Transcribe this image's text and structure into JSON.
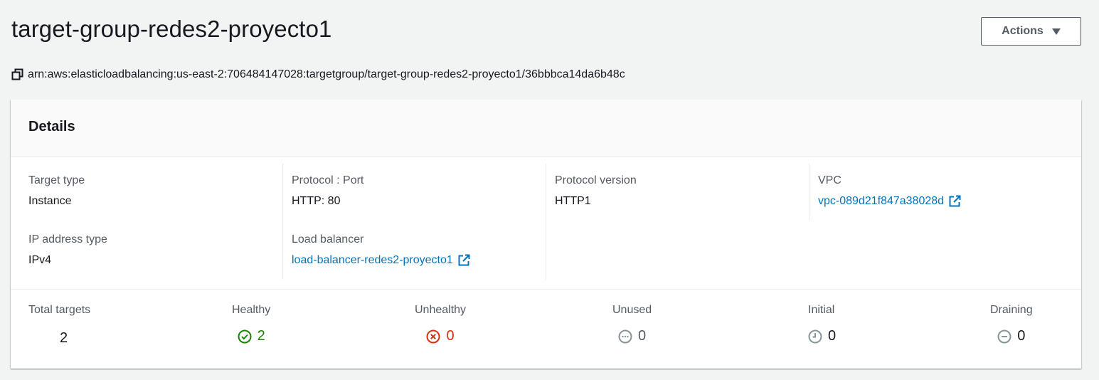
{
  "header": {
    "title": "target-group-redes2-proyecto1",
    "actions_label": "Actions",
    "arn": "arn:aws:elasticloadbalancing:us-east-2:706484147028:targetgroup/target-group-redes2-proyecto1/36bbbca14da6b48c"
  },
  "details": {
    "title": "Details",
    "target_type": {
      "label": "Target type",
      "value": "Instance"
    },
    "protocol_port": {
      "label": "Protocol : Port",
      "value": "HTTP: 80"
    },
    "protocol_version": {
      "label": "Protocol version",
      "value": "HTTP1"
    },
    "vpc": {
      "label": "VPC",
      "value": "vpc-089d21f847a38028d"
    },
    "ip_address_type": {
      "label": "IP address type",
      "value": "IPv4"
    },
    "load_balancer": {
      "label": "Load balancer",
      "value": "load-balancer-redes2-proyecto1"
    }
  },
  "stats": {
    "total": {
      "label": "Total targets",
      "value": "2"
    },
    "healthy": {
      "label": "Healthy",
      "value": "2",
      "color": "#1d8102",
      "icon": "check-circle-icon"
    },
    "unhealthy": {
      "label": "Unhealthy",
      "value": "0",
      "color": "#d13212",
      "icon": "x-circle-icon"
    },
    "unused": {
      "label": "Unused",
      "value": "0",
      "color": "#879596",
      "icon": "ellipsis-circle-icon"
    },
    "initial": {
      "label": "Initial",
      "value": "0",
      "color": "#879596",
      "icon": "clock-icon"
    },
    "draining": {
      "label": "Draining",
      "value": "0",
      "color": "#879596",
      "icon": "minus-circle-icon"
    }
  },
  "colors": {
    "link": "#0073bb",
    "label": "#545b64",
    "text": "#16191f"
  }
}
